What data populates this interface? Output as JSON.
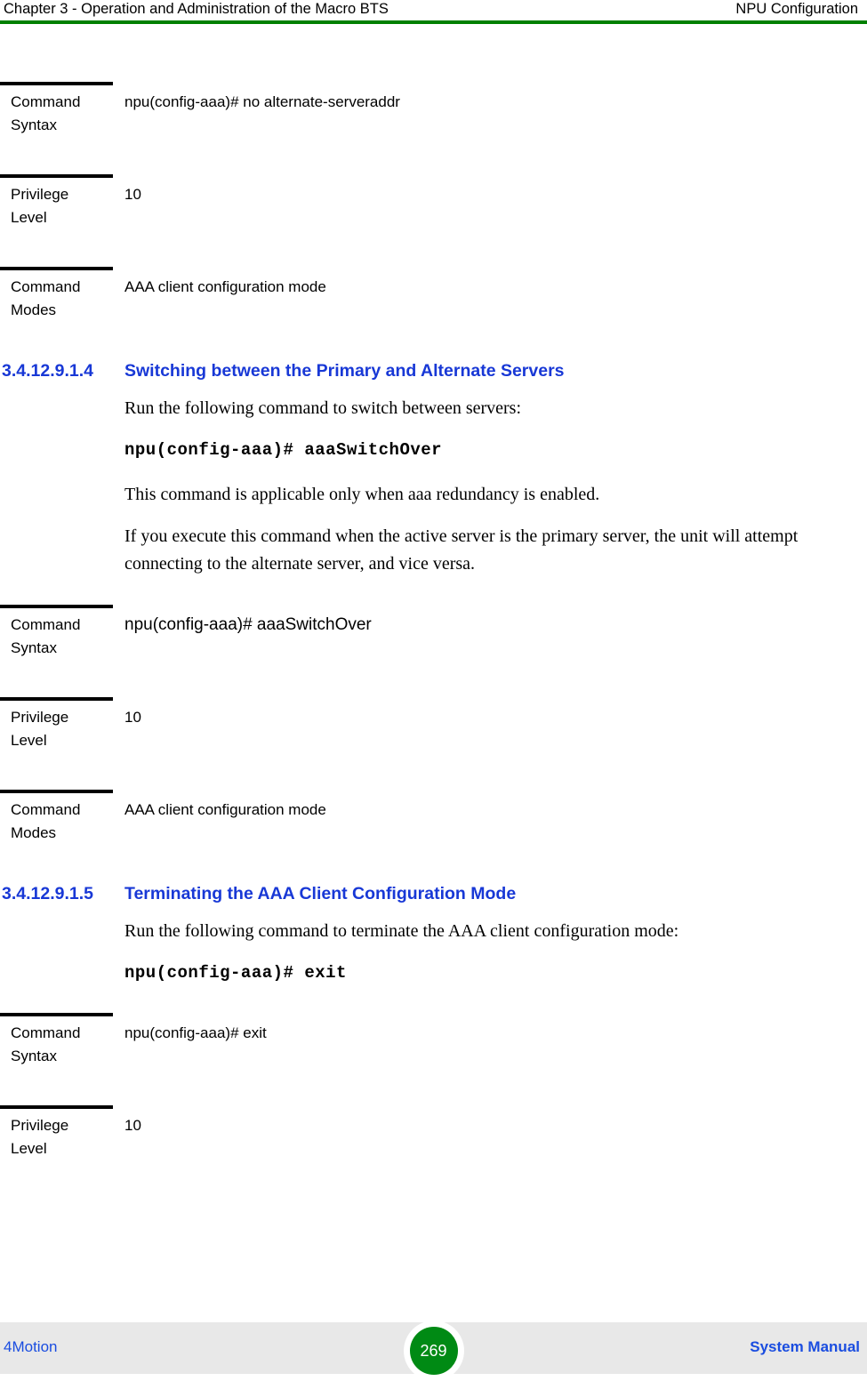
{
  "header": {
    "left": "Chapter 3 - Operation and Administration of the Macro BTS",
    "right": "NPU Configuration",
    "rule_color": "#008000"
  },
  "labels": {
    "command_syntax": "Command Syntax",
    "command_syntax_line1": "Command",
    "command_syntax_line2": "Syntax",
    "privilege_level_line1": "Privilege",
    "privilege_level_line2": "Level",
    "command_modes_line1": "Command",
    "command_modes_line2": "Modes"
  },
  "blocks": {
    "no_alternate_serveraddr": {
      "syntax": "npu(config-aaa)# no alternate-serveraddr",
      "privilege": "10",
      "modes": "AAA client configuration mode"
    },
    "aaa_switch_over": {
      "syntax": "npu(config-aaa)# aaaSwitchOver",
      "privilege": "10",
      "modes": "AAA client configuration mode"
    },
    "exit": {
      "syntax": "npu(config-aaa)# exit",
      "privilege": "10"
    }
  },
  "sections": [
    {
      "number": "3.4.12.9.1.4",
      "title": "Switching between the Primary and Alternate Servers",
      "intro": "Run the following command to switch between servers:",
      "command": "npu(config-aaa)# aaaSwitchOver",
      "note1": "This command is applicable only when aaa redundancy is enabled.",
      "note2": "If you execute this command when the active server is the primary server, the unit will attempt connecting to the alternate server, and vice versa."
    },
    {
      "number": "3.4.12.9.1.5",
      "title": "Terminating the AAA Client Configuration Mode",
      "intro": "Run the following command to terminate the AAA client configuration mode:",
      "command": "npu(config-aaa)# exit"
    }
  ],
  "footer": {
    "left": "4Motion",
    "page_number": "269",
    "right": "System Manual",
    "badge_color": "#008a14",
    "band_color": "#e8e8e8"
  },
  "theme": {
    "heading_blue": "#1838d6",
    "link_blue": "#1a4de0",
    "rule_black": "#000000"
  }
}
